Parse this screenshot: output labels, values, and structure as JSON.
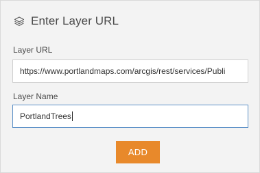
{
  "header": {
    "title": "Enter Layer URL",
    "icon": "layers-icon"
  },
  "layer_url": {
    "label": "Layer URL",
    "value": "https://www.portlandmaps.com/arcgis/rest/services/Publi"
  },
  "layer_name": {
    "label": "Layer Name",
    "value": "PortlandTrees"
  },
  "add_button": {
    "label": "ADD"
  },
  "colors": {
    "accent": "#e8892b",
    "panel_bg": "#f3f3f3",
    "focus_border": "#5b8fc7"
  }
}
